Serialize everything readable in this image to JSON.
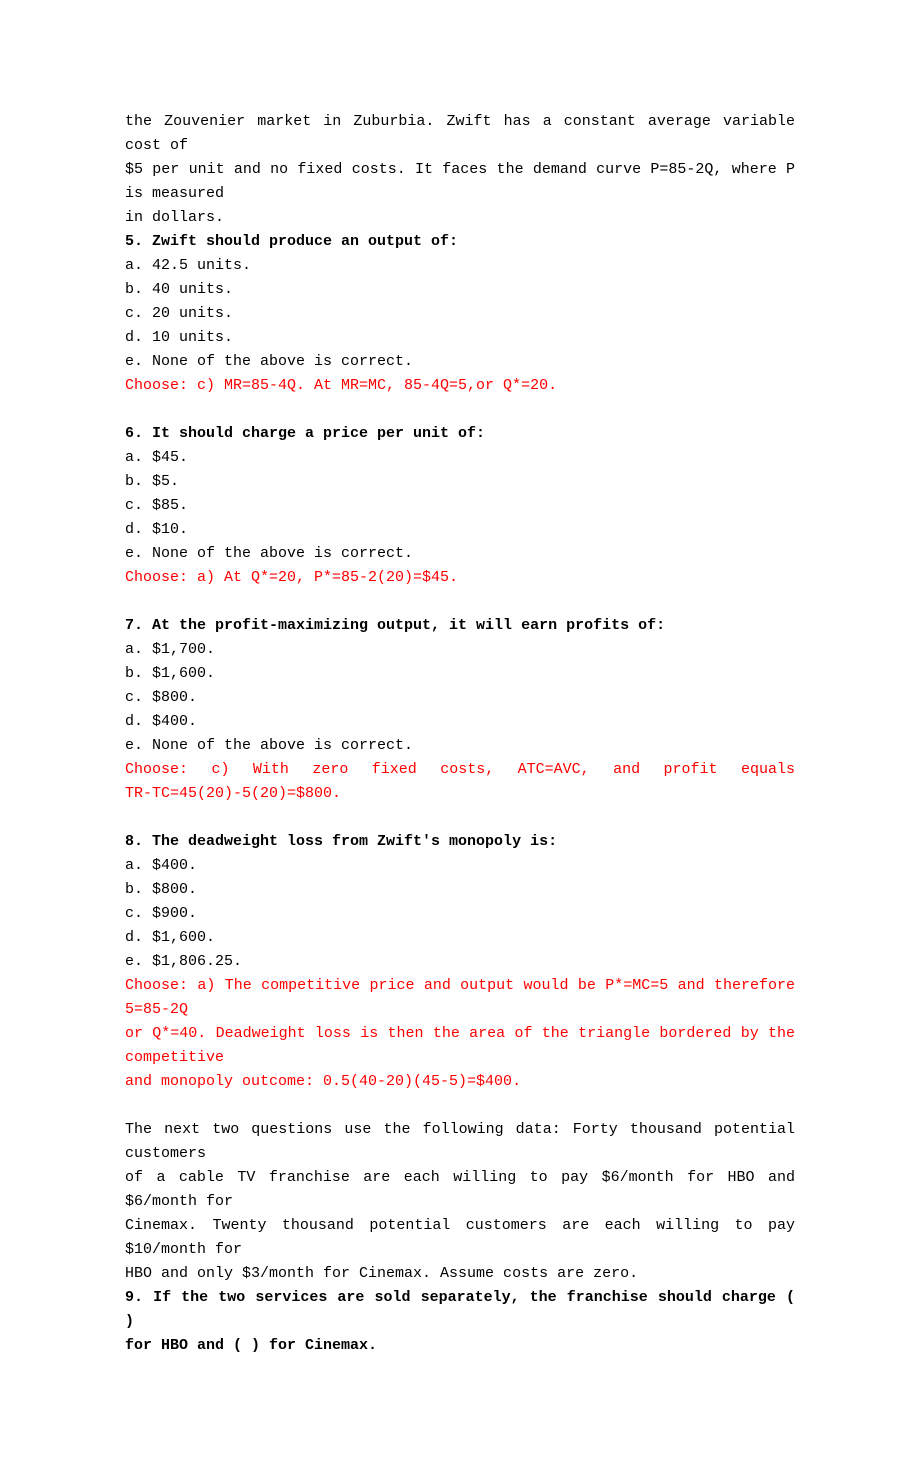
{
  "intro": {
    "line1": "the Zouvenier market in Zuburbia. Zwift has a constant average variable cost of",
    "line2": "$5 per unit and no fixed costs. It faces the demand curve P=85-2Q, where P is measured",
    "line3": "in dollars."
  },
  "q5": {
    "question": "5. Zwift should produce an output of:",
    "a": "a. 42.5 units.",
    "b": "b. 40 units.",
    "c": "c. 20 units.",
    "d": "d. 10 units.",
    "e": "e. None of the above is correct.",
    "answer": "Choose: c) MR=85-4Q. At MR=MC, 85-4Q=5,or Q*=20."
  },
  "q6": {
    "question": "6. It should charge a price per unit of:",
    "a": "a. $45.",
    "b": "b. $5.",
    "c": "c. $85.",
    "d": "d. $10.",
    "e": "e. None of the above is correct.",
    "answer": "Choose: a) At Q*=20, P*=85-2(20)=$45."
  },
  "q7": {
    "question": "7. At the profit-maximizing output, it will earn profits of:",
    "a": "a. $1,700.",
    "b": "b. $1,600.",
    "c": "c. $800.",
    "d": "d. $400.",
    "e": "e. None of the above is correct.",
    "answer_line1": "Choose:   c)   With   zero   fixed   costs,   ATC=AVC,   and   profit   equals",
    "answer_line2": "TR-TC=45(20)-5(20)=$800."
  },
  "q8": {
    "question": "8. The deadweight loss from Zwift's monopoly is:",
    "a": "a. $400.",
    "b": "b. $800.",
    "c": "c. $900.",
    "d": "d. $1,600.",
    "e": "e. $1,806.25.",
    "answer_line1": "Choose: a) The competitive price and output would be P*=MC=5 and therefore 5=85-2Q",
    "answer_line2": "or Q*=40. Deadweight loss is then the area of the triangle bordered by the competitive",
    "answer_line3": "and monopoly outcome: 0.5(40-20)(45-5)=$400."
  },
  "next": {
    "line1": "The next two questions use the following data: Forty thousand potential customers",
    "line2": "of a cable TV franchise are each willing to pay $6/month for HBO and $6/month for",
    "line3": "Cinemax. Twenty thousand potential customers are each willing to pay $10/month for",
    "line4": "HBO and only $3/month for Cinemax. Assume costs are zero.",
    "q9_line1": "9. If the two services are sold separately, the franchise should charge (     )",
    "q9_line2": "for HBO and (     ) for Cinemax."
  }
}
